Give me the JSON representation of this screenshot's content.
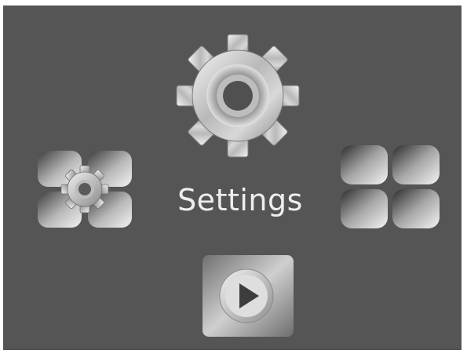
{
  "screen": {
    "title": "Settings",
    "background": "#555555"
  },
  "icons": {
    "center": "gear-icon",
    "left": "settings-grid-icon",
    "right": "app-grid-icon",
    "bottom": "play-icon"
  }
}
